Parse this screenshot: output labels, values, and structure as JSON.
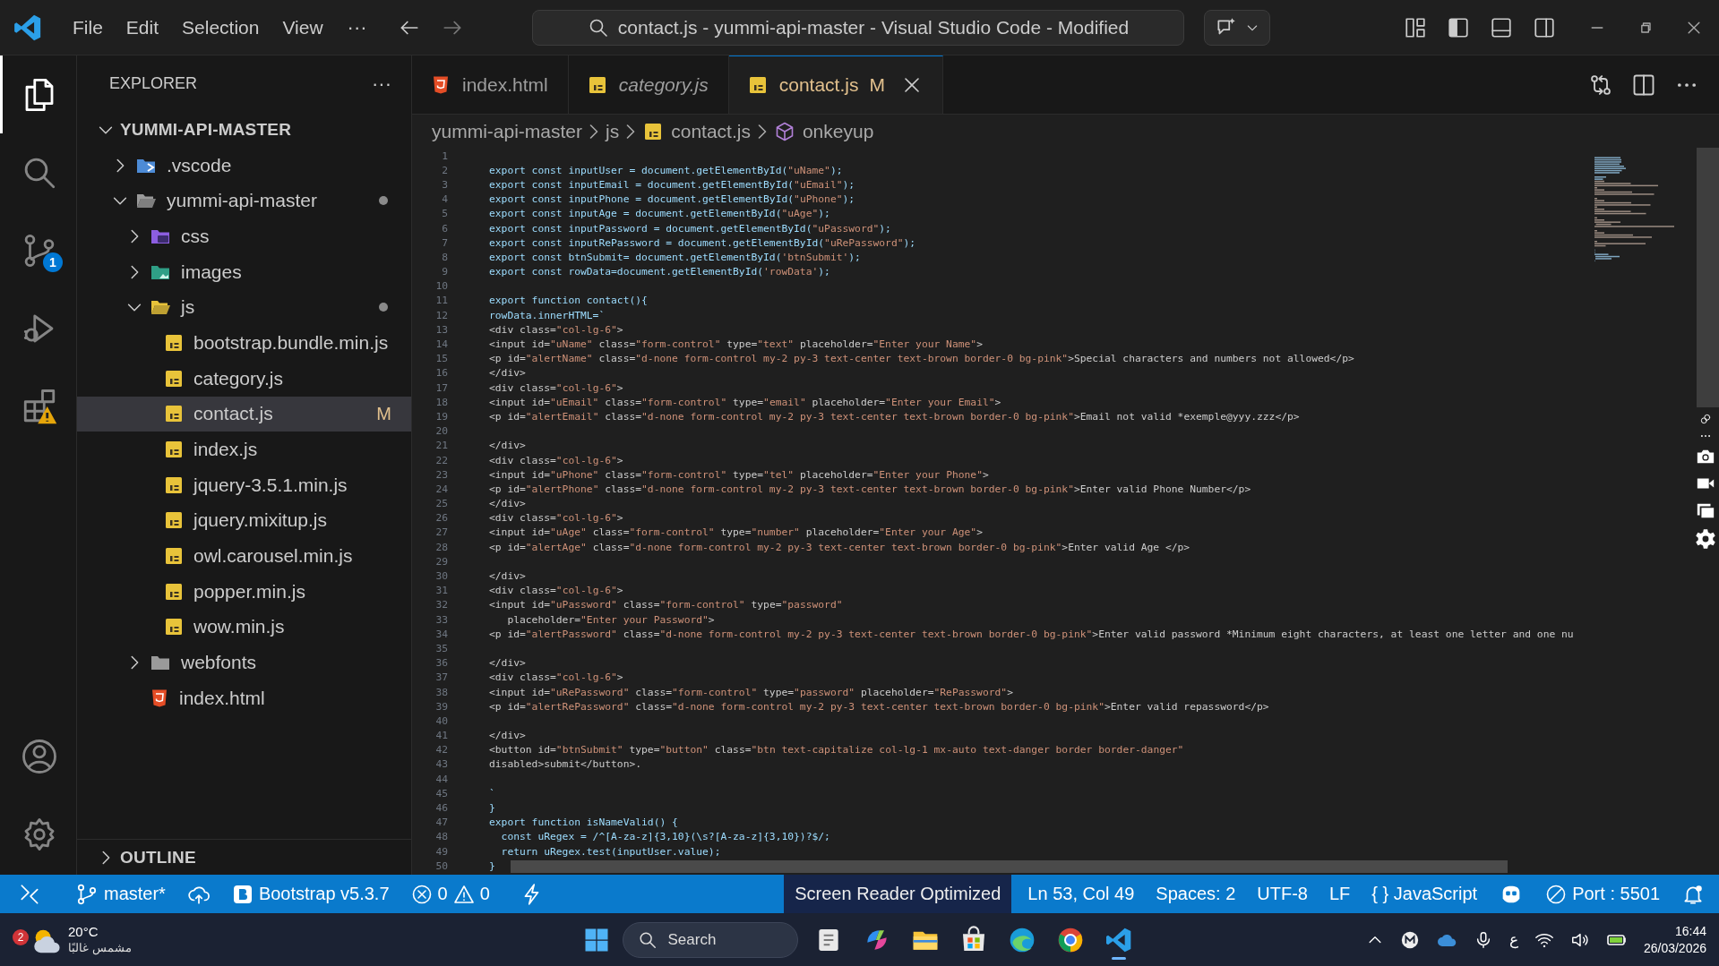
{
  "title_bar": {
    "menu": [
      "File",
      "Edit",
      "Selection",
      "View"
    ],
    "more": "···",
    "command_center": "contact.js - yummi-api-master - Visual Studio Code - Modified"
  },
  "activity_bar": {
    "items": [
      {
        "kind": "files",
        "selected": true
      },
      {
        "kind": "search",
        "selected": false
      },
      {
        "kind": "source-control",
        "selected": false,
        "badge": "1"
      },
      {
        "kind": "run",
        "selected": false
      },
      {
        "kind": "extensions",
        "selected": false
      }
    ],
    "bottom": [
      {
        "kind": "account"
      },
      {
        "kind": "settings"
      }
    ]
  },
  "explorer": {
    "title": "EXPLORER",
    "more": "···",
    "root": {
      "label": "YUMMI-API-MASTER",
      "expanded": true,
      "children": [
        {
          "label": ".vscode",
          "kind": "folder-vscode",
          "expanded": false,
          "selected": false,
          "modified": false
        },
        {
          "label": "yummi-api-master",
          "kind": "folder",
          "expanded": true,
          "selected": false,
          "modified": true,
          "children": [
            {
              "label": "css",
              "kind": "folder-css",
              "expanded": false,
              "selected": false,
              "modified": false
            },
            {
              "label": "images",
              "kind": "folder-images",
              "expanded": false,
              "selected": false,
              "modified": false
            },
            {
              "label": "js",
              "kind": "folder-js",
              "expanded": true,
              "selected": false,
              "modified": true,
              "children": [
                {
                  "label": "bootstrap.bundle.min.js",
                  "kind": "js",
                  "selected": false,
                  "modified": false
                },
                {
                  "label": "category.js",
                  "kind": "js",
                  "selected": false,
                  "modified": false
                },
                {
                  "label": "contact.js",
                  "kind": "js",
                  "selected": true,
                  "modified": true,
                  "badge": "M"
                },
                {
                  "label": "index.js",
                  "kind": "js",
                  "selected": false,
                  "modified": false
                },
                {
                  "label": "jquery-3.5.1.min.js",
                  "kind": "js",
                  "selected": false,
                  "modified": false
                },
                {
                  "label": "jquery.mixitup.js",
                  "kind": "js",
                  "selected": false,
                  "modified": false
                },
                {
                  "label": "owl.carousel.min.js",
                  "kind": "js",
                  "selected": false,
                  "modified": false
                },
                {
                  "label": "popper.min.js",
                  "kind": "js",
                  "selected": false,
                  "modified": false
                },
                {
                  "label": "wow.min.js",
                  "kind": "js",
                  "selected": false,
                  "modified": false
                }
              ]
            },
            {
              "label": "webfonts",
              "kind": "folder",
              "expanded": false,
              "selected": false,
              "modified": false
            },
            {
              "label": "index.html",
              "kind": "html",
              "selected": false,
              "modified": false
            }
          ]
        }
      ]
    },
    "outline": {
      "label": "OUTLINE",
      "expanded": false
    }
  },
  "editor": {
    "tabs": [
      {
        "label": "index.html",
        "kind": "html",
        "selected": false,
        "preview": false,
        "modified": false
      },
      {
        "label": "category.js",
        "kind": "js",
        "selected": false,
        "preview": true,
        "modified": false
      },
      {
        "label": "contact.js",
        "kind": "js",
        "selected": true,
        "preview": false,
        "modified": true,
        "badge": "M"
      }
    ],
    "breadcrumb": [
      {
        "label": "yummi-api-master",
        "kind": "folder"
      },
      {
        "label": "js",
        "kind": "folder"
      },
      {
        "label": "contact.js",
        "kind": "js"
      },
      {
        "label": "onkeyup",
        "kind": "symbol"
      }
    ],
    "lines": [
      {
        "n": "1"
      },
      {
        "n": "2",
        "kind": "js",
        "text": "export const inputUser = document.getElementById(\"uName\");"
      },
      {
        "n": "3",
        "kind": "js",
        "text": "export const inputEmail = document.getElementById(\"uEmail\");"
      },
      {
        "n": "4",
        "kind": "js",
        "text": "export const inputPhone = document.getElementById(\"uPhone\");"
      },
      {
        "n": "5",
        "kind": "js",
        "text": "export const inputAge = document.getElementById(\"uAge\");"
      },
      {
        "n": "6",
        "kind": "js",
        "text": "export const inputPassword = document.getElementById(\"uPassword\");"
      },
      {
        "n": "7",
        "kind": "js",
        "text": "export const inputRePassword = document.getElementById(\"uRePassword\");"
      },
      {
        "n": "8",
        "kind": "js",
        "text": "export const btnSubmit= document.getElementById('btnSubmit');"
      },
      {
        "n": "9",
        "kind": "js",
        "text": "export const rowData=document.getElementById('rowData');"
      },
      {
        "n": "10"
      },
      {
        "n": "11",
        "kind": "js",
        "text": "export function contact(){"
      },
      {
        "n": "12",
        "kind": "js",
        "text": "rowData.innerHTML=`"
      },
      {
        "n": "13",
        "kind": "markup",
        "text": "<div class=\"col-lg-6\">"
      },
      {
        "n": "14",
        "kind": "markup",
        "text": "<input id=\"uName\" class=\"form-control\" type=\"text\" placeholder=\"Enter your Name\">"
      },
      {
        "n": "15",
        "kind": "markup",
        "text": "<p id=\"alertName\" class=\"d-none form-control my-2 py-3 text-center text-brown border-0 bg-pink\">Special characters and numbers not allowed</p>"
      },
      {
        "n": "16",
        "kind": "markup",
        "text": "</div>"
      },
      {
        "n": "17",
        "kind": "markup",
        "text": "<div class=\"col-lg-6\">"
      },
      {
        "n": "18",
        "kind": "markup",
        "text": "<input id=\"uEmail\" class=\"form-control\" type=\"email\" placeholder=\"Enter your Email\">"
      },
      {
        "n": "19",
        "kind": "markup",
        "text": "<p id=\"alertEmail\" class=\"d-none form-control my-2 py-3 text-center text-brown border-0 bg-pink\">Email not valid *exemple@yyy.zzz</p>"
      },
      {
        "n": "20"
      },
      {
        "n": "21",
        "kind": "markup",
        "text": "</div>"
      },
      {
        "n": "22",
        "kind": "markup",
        "text": "<div class=\"col-lg-6\">"
      },
      {
        "n": "23",
        "kind": "markup",
        "text": "<input id=\"uPhone\" class=\"form-control\" type=\"tel\" placeholder=\"Enter your Phone\">"
      },
      {
        "n": "24",
        "kind": "markup",
        "text": "<p id=\"alertPhone\" class=\"d-none form-control my-2 py-3 text-center text-brown border-0 bg-pink\">Enter valid Phone Number</p>"
      },
      {
        "n": "25",
        "kind": "markup",
        "text": "</div>"
      },
      {
        "n": "26",
        "kind": "markup",
        "text": "<div class=\"col-lg-6\">"
      },
      {
        "n": "27",
        "kind": "markup",
        "text": "<input id=\"uAge\" class=\"form-control\" type=\"number\" placeholder=\"Enter your Age\">"
      },
      {
        "n": "28",
        "kind": "markup",
        "text": "<p id=\"alertAge\" class=\"d-none form-control my-2 py-3 text-center text-brown border-0 bg-pink\">Enter valid Age </p>"
      },
      {
        "n": "29"
      },
      {
        "n": "30",
        "kind": "markup",
        "text": "</div>"
      },
      {
        "n": "31",
        "kind": "markup",
        "text": "<div class=\"col-lg-6\">"
      },
      {
        "n": "32",
        "kind": "markup",
        "text": "<input id=\"uPassword\" class=\"form-control\" type=\"password\""
      },
      {
        "n": "33",
        "kind": "markup",
        "text": "   placeholder=\"Enter your Password\">"
      },
      {
        "n": "34",
        "kind": "markup",
        "text": "<p id=\"alertPassword\" class=\"d-none form-control my-2 py-3 text-center text-brown border-0 bg-pink\">Enter valid password *Minimum eight characters, at least one letter and one nu"
      },
      {
        "n": "35"
      },
      {
        "n": "36",
        "kind": "markup",
        "text": "</div>"
      },
      {
        "n": "37",
        "kind": "markup",
        "text": "<div class=\"col-lg-6\">"
      },
      {
        "n": "38",
        "kind": "markup",
        "text": "<input id=\"uRePassword\" class=\"form-control\" type=\"password\" placeholder=\"RePassword\">"
      },
      {
        "n": "39",
        "kind": "markup",
        "text": "<p id=\"alertRePassword\" class=\"d-none form-control my-2 py-3 text-center text-brown border-0 bg-pink\">Enter valid repassword</p>"
      },
      {
        "n": "40"
      },
      {
        "n": "41",
        "kind": "markup",
        "text": "</div>"
      },
      {
        "n": "42",
        "kind": "markup",
        "text": "<button id=\"btnSubmit\" type=\"button\" class=\"btn text-capitalize col-lg-1 mx-auto text-danger border border-danger\""
      },
      {
        "n": "43",
        "kind": "markup",
        "text": "disabled>submit</button>."
      },
      {
        "n": "44"
      },
      {
        "n": "45",
        "kind": "js",
        "text": "`"
      },
      {
        "n": "46",
        "kind": "js",
        "text": "}"
      },
      {
        "n": "47",
        "kind": "js",
        "text": "export function isNameValid() {"
      },
      {
        "n": "48",
        "kind": "js",
        "text": "  const uRegex = /^[A-za-z]{3,10}(\\s?[A-za-z]{3,10})?$/;"
      },
      {
        "n": "49",
        "kind": "js",
        "text": "  return uRegex.test(inputUser.value);"
      },
      {
        "n": "50",
        "kind": "js",
        "text": "}"
      }
    ]
  },
  "status_bar": {
    "left": [
      {
        "kind": "remote"
      },
      {
        "kind": "branch",
        "text": "master*"
      },
      {
        "kind": "sync"
      },
      {
        "kind": "bootstrap",
        "text": "Bootstrap v5.3.7"
      },
      {
        "kind": "problems",
        "errors": "0",
        "warnings": "0"
      },
      {
        "kind": "lightning"
      }
    ],
    "screen_reader": "Screen Reader Optimized",
    "right": [
      {
        "kind": "text",
        "text": "Ln 53, Col 49"
      },
      {
        "kind": "text",
        "text": "Spaces: 2"
      },
      {
        "kind": "text",
        "text": "UTF-8"
      },
      {
        "kind": "text",
        "text": "LF"
      },
      {
        "kind": "language",
        "glyph": "{ }",
        "text": "JavaScript"
      },
      {
        "kind": "copilot"
      },
      {
        "kind": "port",
        "text": "Port : 5501"
      },
      {
        "kind": "bell"
      }
    ]
  },
  "taskbar": {
    "weather": {
      "badge": "2",
      "temp": "20°C",
      "condition": "مشمس غالبًا"
    },
    "search": {
      "placeholder": "Search"
    },
    "apps": [
      {
        "kind": "app",
        "active": false
      },
      {
        "kind": "swirl",
        "active": false
      },
      {
        "kind": "folder",
        "active": false
      },
      {
        "kind": "store",
        "active": false
      },
      {
        "kind": "browser-wave",
        "active": false
      },
      {
        "kind": "browser-ring",
        "active": false
      },
      {
        "kind": "code",
        "active": true
      }
    ],
    "tray": {
      "ime": "ع",
      "time": "16:44",
      "date": "26/03/2026"
    }
  }
}
